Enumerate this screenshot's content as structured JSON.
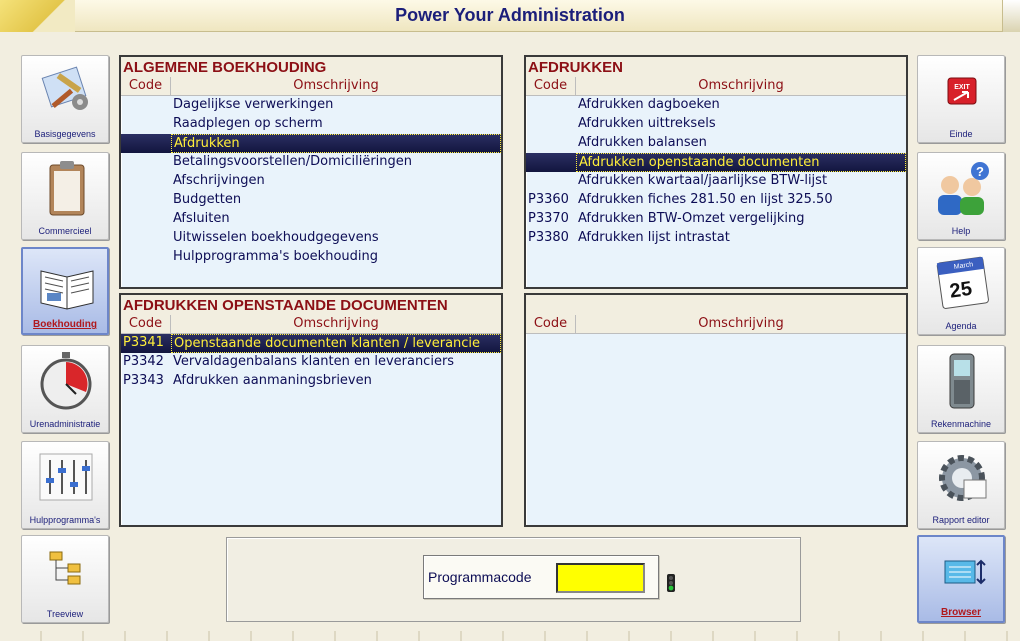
{
  "window": {
    "title": "Power Your Administration"
  },
  "left_nav": [
    {
      "label": "Basisgegevens",
      "icon": "tools-icon"
    },
    {
      "label": "Commercieel",
      "icon": "clipboard-icon"
    },
    {
      "label": "Boekhouding",
      "icon": "book-icon",
      "active": true
    },
    {
      "label": "Urenadministratie",
      "icon": "stopwatch-icon"
    },
    {
      "label": "Hulpprogramma's",
      "icon": "sliders-icon"
    },
    {
      "label": "Treeview",
      "icon": "treeview-icon"
    }
  ],
  "right_nav": [
    {
      "label": "Einde",
      "icon": "exit-icon"
    },
    {
      "label": "Help",
      "icon": "help-people-icon"
    },
    {
      "label": "Agenda",
      "icon": "calendar-icon",
      "calendar_month": "March",
      "calendar_day": "25"
    },
    {
      "label": "Rekenmachine",
      "icon": "phone-icon"
    },
    {
      "label": "Rapport editor",
      "icon": "gear-icon"
    },
    {
      "label": "Browser",
      "icon": "browser-icon",
      "active": true
    }
  ],
  "columns": {
    "code": "Code",
    "description": "Omschrijving"
  },
  "panels": {
    "algemene": {
      "title": "ALGEMENE BOEKHOUDING",
      "rows": [
        {
          "code": "",
          "label": "Dagelijkse verwerkingen"
        },
        {
          "code": "",
          "label": "Raadplegen op scherm"
        },
        {
          "code": "",
          "label": "Afdrukken",
          "selected": true
        },
        {
          "code": "",
          "label": "Betalingsvoorstellen/Domiciliëringen"
        },
        {
          "code": "",
          "label": "Afschrijvingen"
        },
        {
          "code": "",
          "label": "Budgetten"
        },
        {
          "code": "",
          "label": "Afsluiten"
        },
        {
          "code": "",
          "label": "Uitwisselen boekhoudgegevens"
        },
        {
          "code": "",
          "label": "Hulpprogramma's boekhouding"
        }
      ]
    },
    "afdrukken": {
      "title": "AFDRUKKEN",
      "rows": [
        {
          "code": "",
          "label": "Afdrukken dagboeken"
        },
        {
          "code": "",
          "label": "Afdrukken uittreksels"
        },
        {
          "code": "",
          "label": "Afdrukken balansen"
        },
        {
          "code": "",
          "label": "Afdrukken openstaande documenten",
          "selected": true
        },
        {
          "code": "",
          "label": "Afdrukken kwartaal/jaarlijkse BTW-lijst"
        },
        {
          "code": "P3360",
          "label": "Afdrukken fiches 281.50 en lijst 325.50"
        },
        {
          "code": "P3370",
          "label": "Afdrukken BTW-Omzet vergelijking"
        },
        {
          "code": "P3380",
          "label": "Afdrukken lijst intrastat"
        }
      ]
    },
    "openstaande": {
      "title": "AFDRUKKEN OPENSTAANDE DOCUMENTEN",
      "rows": [
        {
          "code": "P3341",
          "label": "Openstaande documenten klanten / leverancie",
          "selected": true
        },
        {
          "code": "P3342",
          "label": "Vervaldagenbalans klanten en leveranciers"
        },
        {
          "code": "P3343",
          "label": "Afdrukken aanmaningsbrieven"
        }
      ]
    },
    "empty": {
      "title": "",
      "rows": []
    }
  },
  "program_code": {
    "label": "Programmacode",
    "value": ""
  }
}
